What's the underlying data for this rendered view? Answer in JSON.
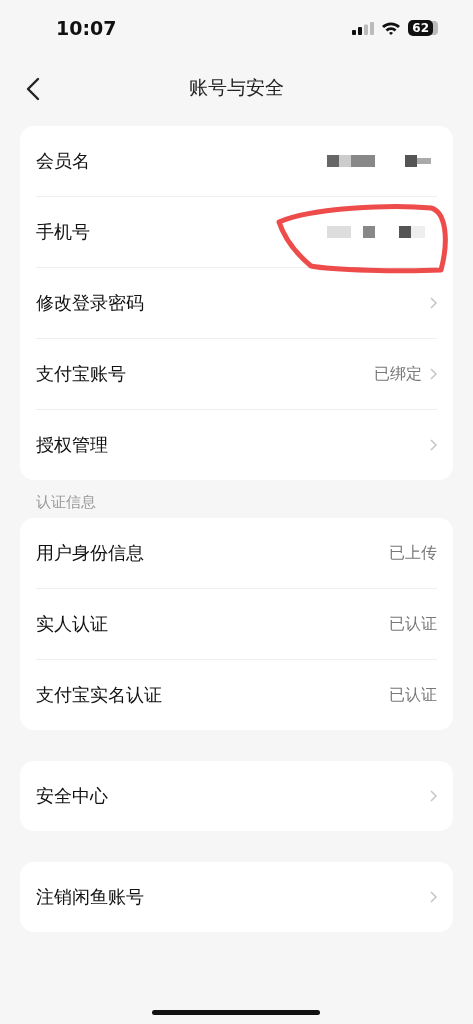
{
  "status_bar": {
    "time": "10:07",
    "battery": "62"
  },
  "nav": {
    "title": "账号与安全"
  },
  "sections": [
    {
      "rows": [
        {
          "label": "会员名",
          "kind": "redacted",
          "chevron": false,
          "circled": false
        },
        {
          "label": "手机号",
          "kind": "redacted",
          "chevron": false,
          "circled": true
        },
        {
          "label": "修改登录密码",
          "kind": "plain",
          "chevron": true,
          "circled": false
        },
        {
          "label": "支付宝账号",
          "kind": "value",
          "value": "已绑定",
          "chevron": true,
          "circled": false
        },
        {
          "label": "授权管理",
          "kind": "plain",
          "chevron": true,
          "circled": false
        }
      ]
    },
    {
      "heading": "认证信息",
      "rows": [
        {
          "label": "用户身份信息",
          "kind": "value",
          "value": "已上传",
          "chevron": false,
          "circled": false
        },
        {
          "label": "实人认证",
          "kind": "value",
          "value": "已认证",
          "chevron": false,
          "circled": false
        },
        {
          "label": "支付宝实名认证",
          "kind": "value",
          "value": "已认证",
          "chevron": false,
          "circled": false
        }
      ]
    },
    {
      "rows": [
        {
          "label": "安全中心",
          "kind": "plain",
          "chevron": true,
          "circled": false
        }
      ]
    },
    {
      "rows": [
        {
          "label": "注销闲鱼账号",
          "kind": "plain",
          "chevron": true,
          "circled": false
        }
      ]
    }
  ]
}
